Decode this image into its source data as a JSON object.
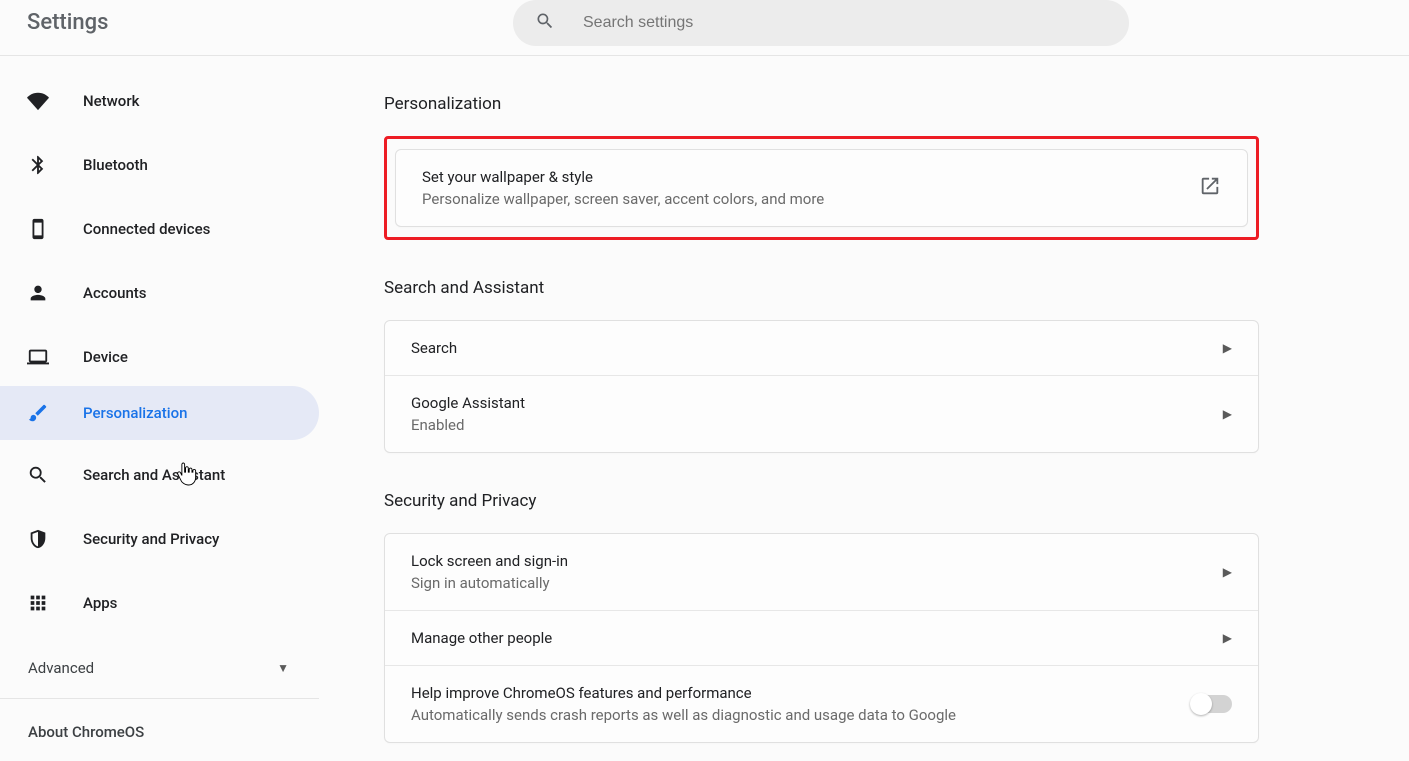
{
  "app": {
    "title": "Settings"
  },
  "search": {
    "placeholder": "Search settings"
  },
  "sidebar": {
    "items": [
      {
        "label": "Network"
      },
      {
        "label": "Bluetooth"
      },
      {
        "label": "Connected devices"
      },
      {
        "label": "Accounts"
      },
      {
        "label": "Device"
      },
      {
        "label": "Personalization"
      },
      {
        "label": "Search and Assistant"
      },
      {
        "label": "Security and Privacy"
      },
      {
        "label": "Apps"
      }
    ],
    "advanced": "Advanced",
    "about": "About ChromeOS"
  },
  "sections": {
    "personalization": {
      "title": "Personalization",
      "wallpaper": {
        "title": "Set your wallpaper & style",
        "sub": "Personalize wallpaper, screen saver, accent colors, and more"
      }
    },
    "search_assistant": {
      "title": "Search and Assistant",
      "rows": [
        {
          "title": "Search"
        },
        {
          "title": "Google Assistant",
          "sub": "Enabled"
        }
      ]
    },
    "security": {
      "title": "Security and Privacy",
      "rows": [
        {
          "title": "Lock screen and sign-in",
          "sub": "Sign in automatically"
        },
        {
          "title": "Manage other people"
        },
        {
          "title": "Help improve ChromeOS features and performance",
          "sub": "Automatically sends crash reports as well as diagnostic and usage data to Google"
        }
      ]
    }
  }
}
